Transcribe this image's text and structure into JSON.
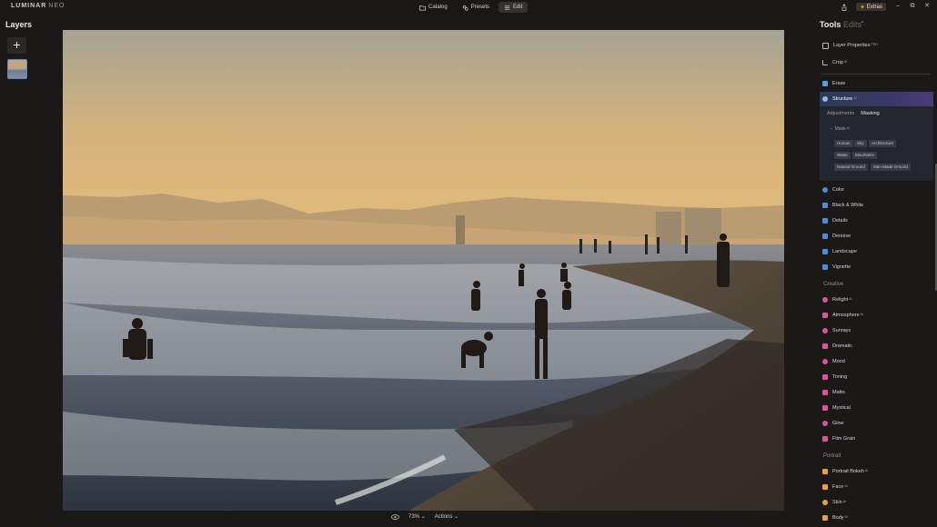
{
  "app": {
    "logo": "LUMINAR",
    "logo_suffix": "NEO"
  },
  "top_tabs": [
    {
      "label": "Catalog",
      "icon": "folder-icon"
    },
    {
      "label": "Presets",
      "icon": "presets-icon"
    },
    {
      "label": "Edit",
      "icon": "sliders-icon",
      "active": true
    }
  ],
  "top_right": {
    "extras_label": "Extras"
  },
  "left": {
    "title": "Layers",
    "add_label": "+"
  },
  "bottom_bar": {
    "zoom": "73%",
    "actions": "Actions"
  },
  "panel": {
    "title": "Tools",
    "tab2": "Edits",
    "tab2_dot": "•",
    "top_items": [
      {
        "label": "Layer Properties",
        "badge": "PRO",
        "icon": "layers-icon"
      },
      {
        "label": "Crop",
        "badge": "AI",
        "icon": "crop-icon"
      }
    ],
    "erase": {
      "label": "Erase",
      "icon": "eraser-icon"
    },
    "structure": {
      "label": "Structure",
      "badge": "AI",
      "icon": "structure-icon"
    },
    "structure_tabs": [
      "Adjustments",
      "Masking"
    ],
    "mask_label": "Mask",
    "mask_badge": "AI",
    "mask_chips": [
      "Human",
      "Sky",
      "Architecture",
      "Water",
      "Mountains",
      "Natural Ground",
      "Man-Made Ground"
    ],
    "essentials": [
      {
        "label": "Color",
        "icon": "color-icon"
      },
      {
        "label": "Black & White",
        "icon": "bw-icon"
      },
      {
        "label": "Details",
        "icon": "details-icon"
      },
      {
        "label": "Denoise",
        "icon": "denoise-icon"
      },
      {
        "label": "Landscape",
        "icon": "landscape-icon"
      },
      {
        "label": "Vignette",
        "icon": "vignette-icon"
      }
    ],
    "creative_title": "Creative",
    "creative": [
      {
        "label": "Relight",
        "badge": "AI",
        "icon": "relight-icon"
      },
      {
        "label": "Atmosphere",
        "badge": "AI",
        "icon": "atmosphere-icon"
      },
      {
        "label": "Sunrays",
        "icon": "sunrays-icon"
      },
      {
        "label": "Dramatic",
        "icon": "dramatic-icon"
      },
      {
        "label": "Mood",
        "icon": "mood-icon"
      },
      {
        "label": "Toning",
        "icon": "toning-icon"
      },
      {
        "label": "Matte",
        "icon": "matte-icon"
      },
      {
        "label": "Mystical",
        "icon": "mystical-icon"
      },
      {
        "label": "Glow",
        "icon": "glow-icon"
      },
      {
        "label": "Film Grain",
        "icon": "film-grain-icon"
      }
    ],
    "portrait_title": "Portrait",
    "portrait": [
      {
        "label": "Portrait Bokeh",
        "badge": "AI",
        "icon": "bokeh-icon"
      },
      {
        "label": "Face",
        "badge": "AI",
        "icon": "face-icon"
      },
      {
        "label": "Skin",
        "badge": "AI",
        "icon": "skin-icon"
      },
      {
        "label": "Body",
        "badge": "AI",
        "icon": "body-icon"
      }
    ]
  },
  "colors": {
    "accent": "#5d86c9",
    "essentials_icon": "#4e8bdc",
    "creative_icon": "#e0529a",
    "portrait_icon": "#e8a23a",
    "erase_icon": "#5aa0e0"
  }
}
